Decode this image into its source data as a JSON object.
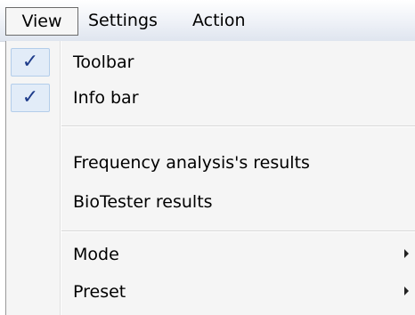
{
  "menubar": {
    "items": [
      {
        "label": "View"
      },
      {
        "label": "Settings"
      },
      {
        "label": "Action"
      }
    ]
  },
  "view_menu": {
    "check_glyph": "✓",
    "items": [
      {
        "label": "Toolbar",
        "checked": true
      },
      {
        "label": "Info bar",
        "checked": true
      },
      {
        "label": "Frequency analysis's results"
      },
      {
        "label": "BioTester results"
      },
      {
        "label": "Mode",
        "submenu": true,
        "icon": "submenu-arrow-icon"
      },
      {
        "label": "Preset",
        "submenu": true,
        "icon": "submenu-arrow-icon"
      }
    ]
  },
  "colors": {
    "check": "#1d3b8a",
    "check_highlight": "#e2ecf8",
    "menu_background": "#f5f5f5"
  }
}
